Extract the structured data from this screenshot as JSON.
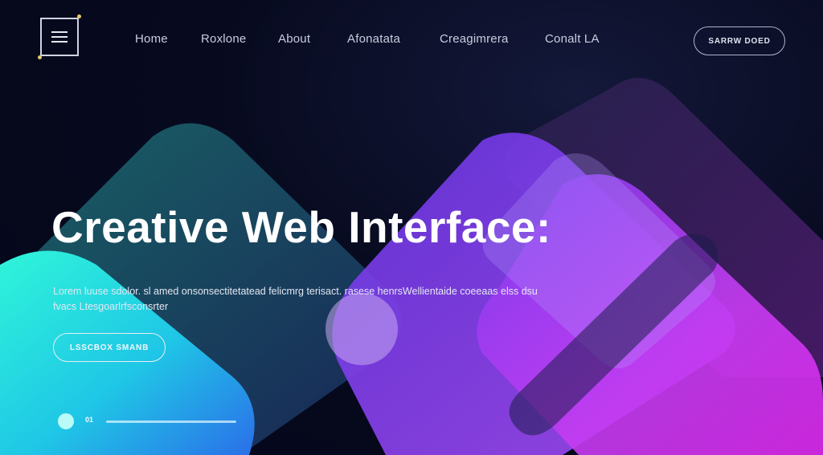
{
  "header": {
    "logo_icon": "menu-lines-icon",
    "nav": [
      {
        "label": "Home"
      },
      {
        "label": "Roxlone"
      },
      {
        "label": "About"
      },
      {
        "label": "Afonatata"
      },
      {
        "label": "Creagimrera"
      },
      {
        "label": "Conalt LA"
      }
    ],
    "cta_label": "SARRW DOED"
  },
  "hero": {
    "title": "Creative Web Interface:",
    "body": "Lorem luuse sdolor. sl amed onsonsectitetatead felicmrg terisact. rasese henrsWellientaide coeeaas elss dsu fvacs Ltesgoarlrfsconsrter",
    "button_label": "LSSCBOX SMANB"
  },
  "slider": {
    "current": "01",
    "progress": 1
  },
  "colors": {
    "background": "#050718",
    "teal": "#17d6d6",
    "cyan": "#2fe6f0",
    "purple": "#8a3cf0",
    "magenta": "#d42df5"
  }
}
